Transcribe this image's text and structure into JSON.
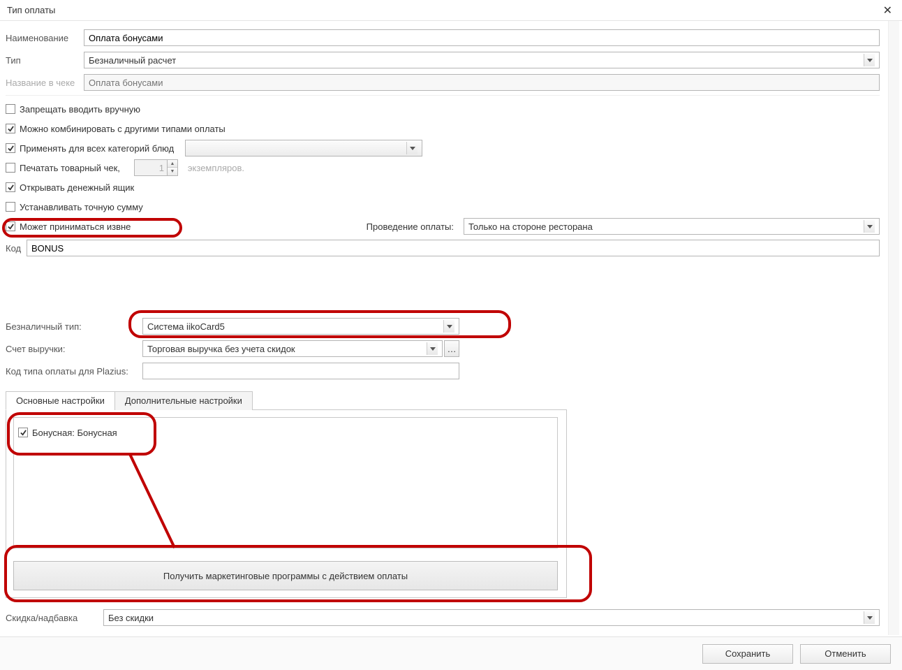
{
  "window": {
    "title": "Тип оплаты"
  },
  "fields": {
    "name_label": "Наименование",
    "name_value": "Оплата бонусами",
    "type_label": "Тип",
    "type_value": "Безналичный расчет",
    "receipt_name_label": "Название в чеке",
    "receipt_name_placeholder": "Оплата бонусами",
    "code_label": "Код",
    "code_value": "BONUS"
  },
  "checks": {
    "forbid_manual": "Запрещать вводить вручную",
    "combine": "Можно комбинировать с другими типами оплаты",
    "apply_all_cat": "Применять для всех категорий блюд",
    "print_receipt": "Печатать товарный чек,",
    "copies_value": "1",
    "copies_suffix": "экземпляров.",
    "open_drawer": "Открывать денежный ящик",
    "exact_amount": "Устанавливать точную сумму",
    "external": "Может приниматься извне"
  },
  "processing": {
    "label": "Проведение оплаты:",
    "value": "Только на стороне ресторана"
  },
  "section2": {
    "cashless_type_label": "Безналичный тип:",
    "cashless_type_value": "Система iikoCard5",
    "revenue_acc_label": "Счет выручки:",
    "revenue_acc_value": "Торговая выручка без учета скидок",
    "plazius_code_label": "Код типа оплаты для Plazius:",
    "plazius_code_value": ""
  },
  "tabs": {
    "main": "Основные настройки",
    "extra": "Дополнительные настройки"
  },
  "bonus_item": "Бонусная: Бонусная",
  "get_programs_btn": "Получить маркетинговые программы с действием оплаты",
  "discount": {
    "label": "Скидка/надбавка",
    "value": "Без скидки"
  },
  "buttons": {
    "save": "Сохранить",
    "cancel": "Отменить"
  }
}
